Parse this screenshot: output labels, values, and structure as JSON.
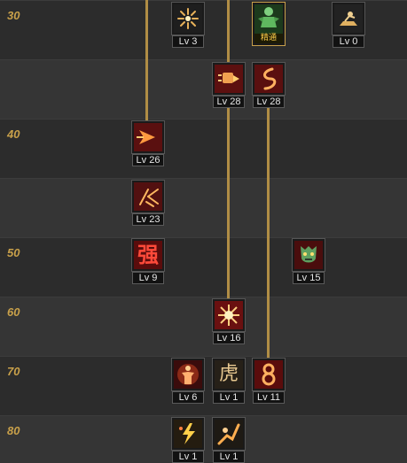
{
  "rows": [
    {
      "label": "30"
    },
    {
      "label": ""
    },
    {
      "label": "40"
    },
    {
      "label": ""
    },
    {
      "label": "50"
    },
    {
      "label": "60"
    },
    {
      "label": "70"
    },
    {
      "label": "80"
    }
  ],
  "skills": [
    {
      "name": "burst-skill-icon",
      "level": "Lv 3"
    },
    {
      "name": "green-warrior-skill-icon",
      "badge": "精通"
    },
    {
      "name": "rider-skill-icon",
      "level": "Lv 0"
    },
    {
      "name": "fist-strike-skill-icon",
      "level": "Lv 28"
    },
    {
      "name": "whirl-kick-skill-icon",
      "level": "Lv 28"
    },
    {
      "name": "arrow-dash-skill-icon",
      "level": "Lv 26"
    },
    {
      "name": "slash-kick-skill-icon",
      "level": "Lv 23"
    },
    {
      "name": "strength-glyph-skill-icon",
      "level": "Lv 9",
      "glyph": "强"
    },
    {
      "name": "demon-mask-skill-icon",
      "level": "Lv 15"
    },
    {
      "name": "energy-burst-skill-icon",
      "level": "Lv 16"
    },
    {
      "name": "power-aura-skill-icon",
      "level": "Lv 6"
    },
    {
      "name": "tiger-glyph-skill-icon",
      "level": "Lv 1",
      "glyph": "虎"
    },
    {
      "name": "spiral-skill-icon",
      "level": "Lv 11"
    },
    {
      "name": "lightning-punch-skill-icon",
      "level": "Lv 1"
    },
    {
      "name": "leap-kick-skill-icon",
      "level": "Lv 1"
    }
  ]
}
